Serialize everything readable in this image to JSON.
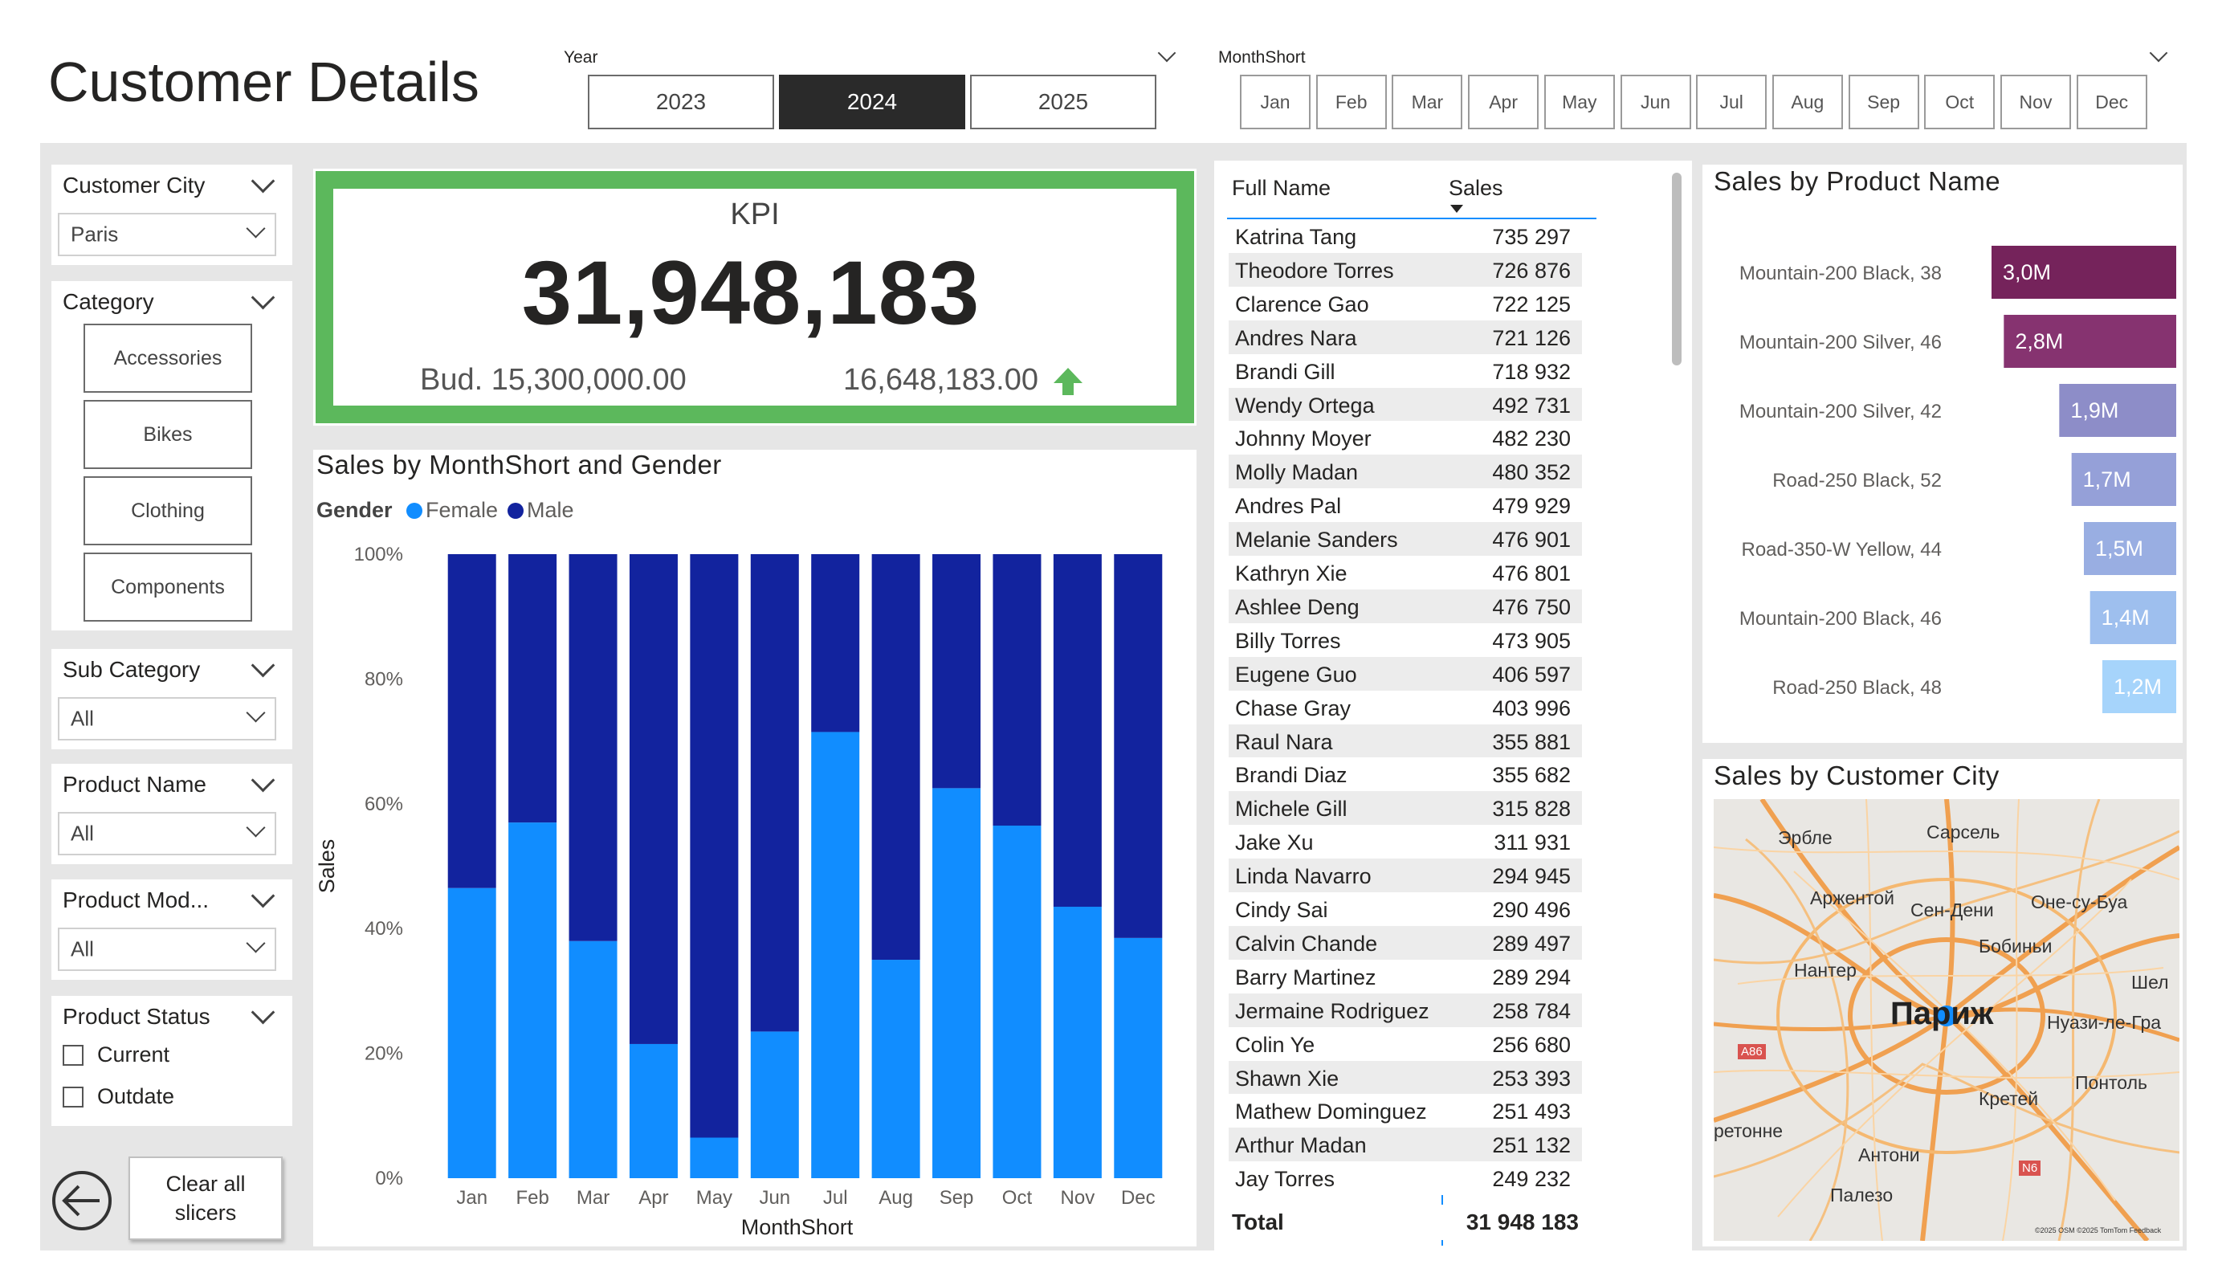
{
  "page": {
    "title": "Customer Details"
  },
  "year_slicer": {
    "label": "Year",
    "options": [
      "2023",
      "2024",
      "2025"
    ],
    "selected": "2024"
  },
  "month_slicer": {
    "label": "MonthShort",
    "options": [
      "Jan",
      "Feb",
      "Mar",
      "Apr",
      "May",
      "Jun",
      "Jul",
      "Aug",
      "Sep",
      "Oct",
      "Nov",
      "Dec"
    ]
  },
  "filters": {
    "customer_city": {
      "label": "Customer City",
      "value": "Paris"
    },
    "category": {
      "label": "Category",
      "options": [
        "Accessories",
        "Bikes",
        "Clothing",
        "Components"
      ]
    },
    "sub_category": {
      "label": "Sub Category",
      "value": "All"
    },
    "product_name": {
      "label": "Product Name",
      "value": "All"
    },
    "product_model": {
      "label": "Product Mod...",
      "value": "All"
    },
    "product_status": {
      "label": "Product Status",
      "options": [
        "Current",
        "Outdate"
      ]
    },
    "clear_button": "Clear all\nslicers"
  },
  "kpi": {
    "title": "KPI",
    "value": "31,948,183",
    "budget": "Bud. 15,300,000.00",
    "delta": "16,648,183.00",
    "colors": {
      "border": "#5cb85c",
      "arrow": "#5cb85c"
    }
  },
  "chart_data": {
    "type": "bar",
    "title": "Sales by MonthShort and Gender",
    "stacked": "100%",
    "legend_title": "Gender",
    "categories": [
      "Jan",
      "Feb",
      "Mar",
      "Apr",
      "May",
      "Jun",
      "Jul",
      "Aug",
      "Sep",
      "Oct",
      "Nov",
      "Dec"
    ],
    "series": [
      {
        "name": "Female",
        "color": "#118dff",
        "values": [
          46.5,
          57,
          38,
          21.5,
          6.5,
          23.5,
          71.5,
          35,
          62.5,
          56.5,
          43.5,
          38.5
        ]
      },
      {
        "name": "Male",
        "color": "#12239e",
        "values": [
          53.5,
          43,
          62,
          78.5,
          93.5,
          76.5,
          28.5,
          65,
          37.5,
          43.5,
          56.5,
          61.5
        ]
      }
    ],
    "xlabel": "MonthShort",
    "ylabel": "Sales",
    "yticks": [
      "0%",
      "20%",
      "40%",
      "60%",
      "80%",
      "100%"
    ],
    "ylim": [
      0,
      100
    ]
  },
  "table": {
    "headers": [
      "Full Name",
      "Sales"
    ],
    "rows": [
      [
        "Katrina Tang",
        "735 297"
      ],
      [
        "Theodore Torres",
        "726 876"
      ],
      [
        "Clarence Gao",
        "722 125"
      ],
      [
        "Andres Nara",
        "721 126"
      ],
      [
        "Brandi Gill",
        "718 932"
      ],
      [
        "Wendy Ortega",
        "492 731"
      ],
      [
        "Johnny Moyer",
        "482 230"
      ],
      [
        "Molly Madan",
        "480 352"
      ],
      [
        "Andres Pal",
        "479 929"
      ],
      [
        "Melanie Sanders",
        "476 901"
      ],
      [
        "Kathryn Xie",
        "476 801"
      ],
      [
        "Ashlee Deng",
        "476 750"
      ],
      [
        "Billy Torres",
        "473 905"
      ],
      [
        "Eugene Guo",
        "406 597"
      ],
      [
        "Chase Gray",
        "403 996"
      ],
      [
        "Raul Nara",
        "355 881"
      ],
      [
        "Brandi Diaz",
        "355 682"
      ],
      [
        "Michele Gill",
        "315 828"
      ],
      [
        "Jake Xu",
        "311 931"
      ],
      [
        "Linda Navarro",
        "294 945"
      ],
      [
        "Cindy Sai",
        "290 496"
      ],
      [
        "Calvin Chande",
        "289 497"
      ],
      [
        "Barry Martinez",
        "289 294"
      ],
      [
        "Jermaine Rodriguez",
        "258 784"
      ],
      [
        "Colin Ye",
        "256 680"
      ],
      [
        "Shawn Xie",
        "253 393"
      ],
      [
        "Mathew Dominguez",
        "251 493"
      ],
      [
        "Arthur Madan",
        "251 132"
      ],
      [
        "Jay Torres",
        "249 232"
      ]
    ],
    "total_label": "Total",
    "total_value": "31 948 183"
  },
  "product_chart": {
    "title": "Sales by Product Name",
    "items": [
      {
        "name": "Mountain-200 Black, 38",
        "label": "3,0M",
        "value": 3.0,
        "color": "#75235b"
      },
      {
        "name": "Mountain-200 Silver, 46",
        "label": "2,8M",
        "value": 2.8,
        "color": "#863370"
      },
      {
        "name": "Mountain-200 Silver, 42",
        "label": "1,9M",
        "value": 1.9,
        "color": "#8d8dc8"
      },
      {
        "name": "Road-250 Black, 52",
        "label": "1,7M",
        "value": 1.7,
        "color": "#95a0d8"
      },
      {
        "name": "Road-350-W Yellow, 44",
        "label": "1,5M",
        "value": 1.5,
        "color": "#99aee2"
      },
      {
        "name": "Mountain-200 Black, 46",
        "label": "1,4M",
        "value": 1.4,
        "color": "#9ebfee"
      },
      {
        "name": "Road-250 Black, 48",
        "label": "1,2M",
        "value": 1.2,
        "color": "#a6d4fb"
      }
    ]
  },
  "map": {
    "title": "Sales by Customer City",
    "labels": [
      "Эрбле",
      "Сарсель",
      "Аржентой",
      "Сен-Дени",
      "Оне-су-Буа",
      "Бобиньи",
      "Нантер",
      "Париж",
      "Нуази-ле-Гра",
      "Шел",
      "Кретей",
      "Понтоль",
      "ретонне",
      "Антони",
      "Палезо",
      "A86",
      "N6"
    ],
    "attribution": "©2025 OSM ©2025 TomTom Feedback"
  }
}
